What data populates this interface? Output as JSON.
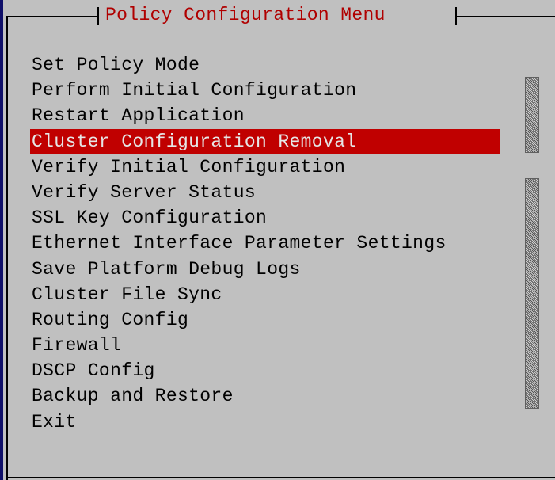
{
  "menu": {
    "title": "Policy Configuration Menu",
    "selected_index": 3,
    "items": [
      {
        "label": "Set Policy Mode"
      },
      {
        "label": "Perform Initial Configuration"
      },
      {
        "label": "Restart Application"
      },
      {
        "label": "Cluster Configuration Removal"
      },
      {
        "label": "Verify Initial Configuration"
      },
      {
        "label": "Verify Server Status"
      },
      {
        "label": "SSL Key Configuration"
      },
      {
        "label": "Ethernet Interface Parameter Settings"
      },
      {
        "label": "Save Platform Debug Logs"
      },
      {
        "label": "Cluster File Sync"
      },
      {
        "label": "Routing Config"
      },
      {
        "label": "Firewall"
      },
      {
        "label": "DSCP Config"
      },
      {
        "label": "Backup and Restore"
      },
      {
        "label": "Exit"
      }
    ]
  },
  "colors": {
    "background": "#c0c0c0",
    "title_text": "#b00000",
    "highlight_bg": "#c00000",
    "highlight_text": "#e6e6e6",
    "text": "#000000"
  }
}
